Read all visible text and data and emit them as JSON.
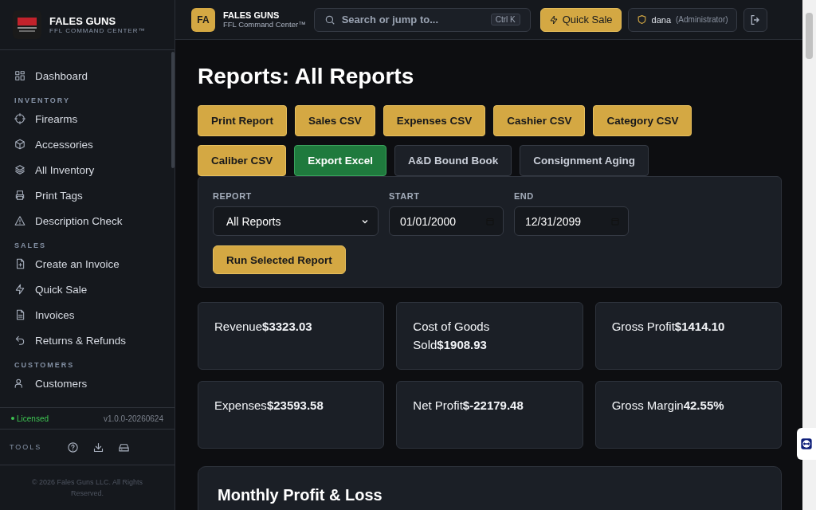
{
  "brand": {
    "name": "FALES GUNS",
    "subtitle": "FFL COMMAND CENTER™"
  },
  "sidebar": {
    "items": [
      {
        "kind": "link",
        "label": "Dashboard"
      },
      {
        "kind": "section",
        "label": "INVENTORY"
      },
      {
        "kind": "link",
        "label": "Firearms"
      },
      {
        "kind": "link",
        "label": "Accessories"
      },
      {
        "kind": "link",
        "label": "All Inventory"
      },
      {
        "kind": "link",
        "label": "Print Tags"
      },
      {
        "kind": "link",
        "label": "Description Check"
      },
      {
        "kind": "section",
        "label": "SALES"
      },
      {
        "kind": "link",
        "label": "Create an Invoice"
      },
      {
        "kind": "link",
        "label": "Quick Sale"
      },
      {
        "kind": "link",
        "label": "Invoices"
      },
      {
        "kind": "link",
        "label": "Returns & Refunds"
      },
      {
        "kind": "section",
        "label": "CUSTOMERS"
      },
      {
        "kind": "link",
        "label": "Customers"
      }
    ],
    "license": "Licensed",
    "version": "v1.0.0-20260624",
    "tools_label": "TOOLS",
    "copyright": "© 2026 Fales Guns LLC. All Rights Reserved."
  },
  "topbar": {
    "badge": "FA",
    "title": "FALES GUNS",
    "subtitle": "FFL Command Center™",
    "search": {
      "placeholder": "Search or jump to...",
      "shortcut": "Ctrl K"
    },
    "quick_sale": "Quick Sale",
    "user": "dana",
    "role": "(Administrator)"
  },
  "page_title": "Reports: All Reports",
  "buttons": [
    {
      "label": "Print Report",
      "kind": "gold"
    },
    {
      "label": "Sales CSV",
      "kind": "gold"
    },
    {
      "label": "Expenses CSV",
      "kind": "gold"
    },
    {
      "label": "Cashier CSV",
      "kind": "gold"
    },
    {
      "label": "Category CSV",
      "kind": "gold"
    },
    {
      "label": "Caliber CSV",
      "kind": "gold"
    },
    {
      "label": "Export Excel",
      "kind": "green"
    },
    {
      "label": "A&D Bound Book",
      "kind": "dark"
    },
    {
      "label": "Consignment Aging",
      "kind": "dark"
    }
  ],
  "filters": {
    "report": {
      "label": "REPORT",
      "value": "All Reports"
    },
    "start": {
      "label": "START",
      "value": "01/01/2000"
    },
    "end": {
      "label": "END",
      "value": "12/31/2099"
    },
    "run": "Run Selected Report"
  },
  "stats": [
    {
      "text": "Revenue**$3323.03**"
    },
    {
      "text": "Cost of Goods Sold**$1908.93**"
    },
    {
      "text": "Gross Profit**$1414.10**"
    },
    {
      "text": "Expenses**$23593.58**"
    },
    {
      "text": "Net Profit**$-22179.48**"
    },
    {
      "text": "Gross Margin**42.55%**"
    }
  ],
  "section_title": "Monthly Profit & Loss"
}
